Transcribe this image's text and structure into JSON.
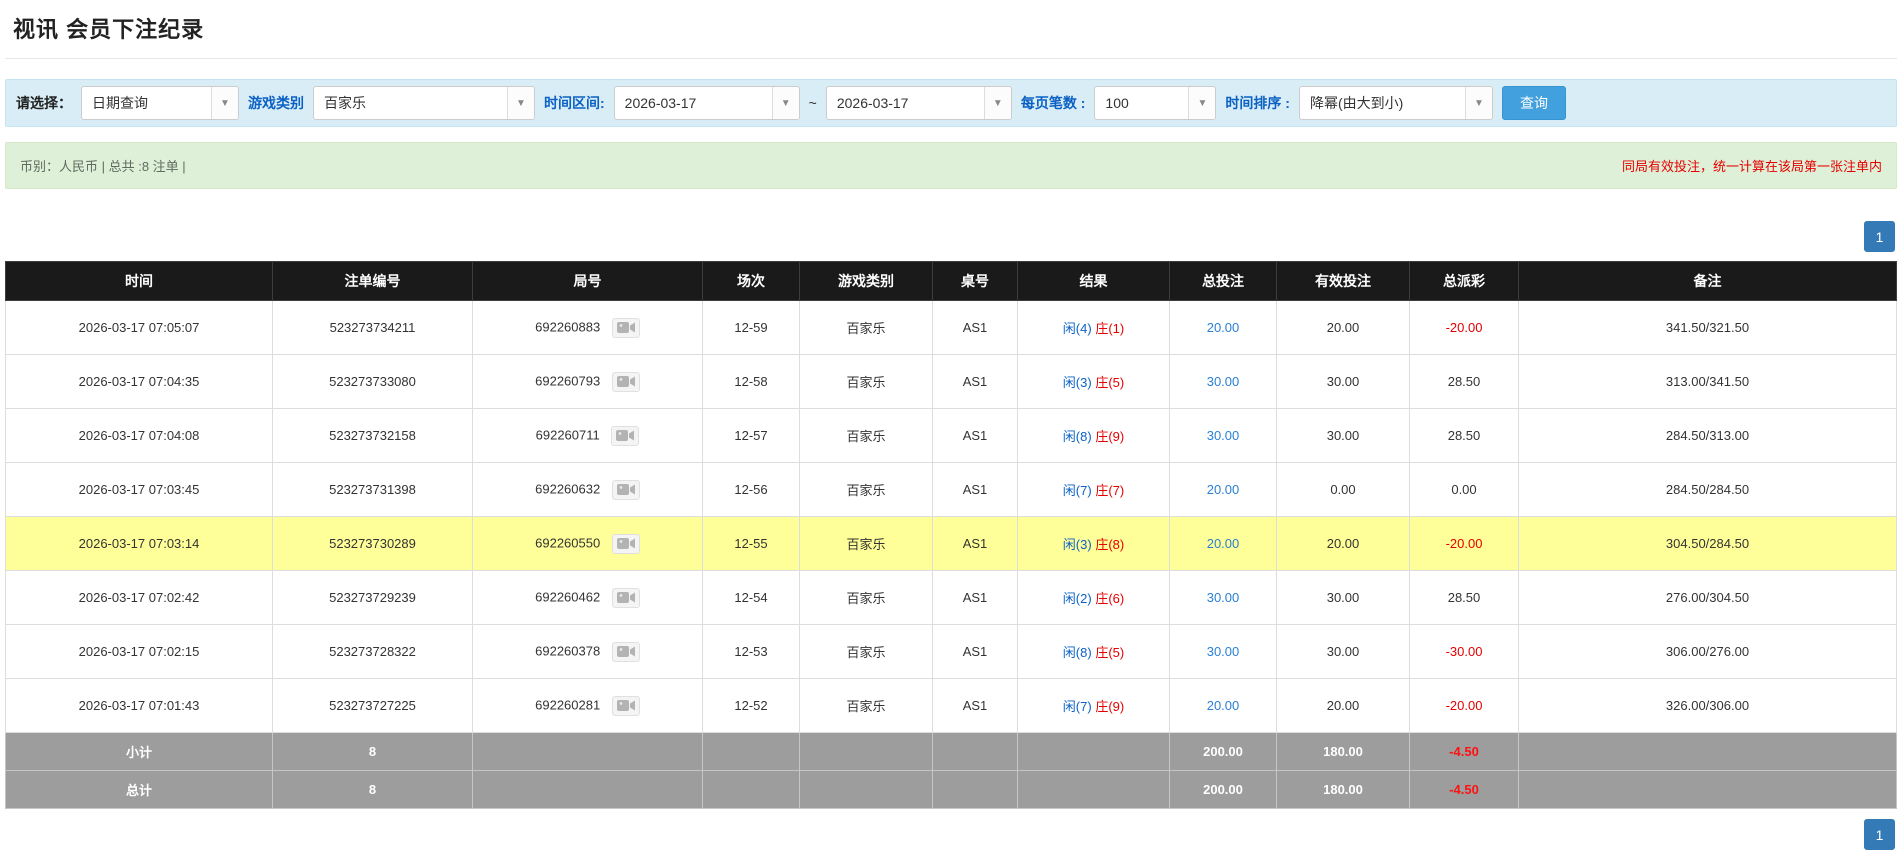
{
  "page": {
    "title": "视讯 会员下注纪录"
  },
  "filters": {
    "select_label": "请选择：",
    "query_type_value": "日期查询",
    "game_category_label": "游戏类别",
    "game_category_value": "百家乐",
    "time_range_label": "时间区间:",
    "date_from_value": "2026-03-17",
    "range_separator": "~",
    "date_to_value": "2026-03-17",
    "page_size_label": "每页笔数 :",
    "page_size_value": "100",
    "sort_label": "时间排序 :",
    "sort_value": "降幂(由大到小)",
    "search_label": "查询"
  },
  "info_bar": {
    "summary": "币别：人民币 | 总共 :8 注单 |",
    "notice": "同局有效投注，统一计算在该局第一张注单内"
  },
  "pagination": {
    "current_page": "1"
  },
  "table": {
    "headers": [
      "时间",
      "注单编号",
      "局号",
      "场次",
      "游戏类别",
      "桌号",
      "结果",
      "总投注",
      "有效投注",
      "总派彩",
      "备注"
    ],
    "rows": [
      {
        "time": "2026-03-17 07:05:07",
        "bet_id": "523273734211",
        "round_id": "692260883",
        "session": "12-59",
        "game": "百家乐",
        "table_no": "AS1",
        "result_player": "闲(4)",
        "result_banker": "庄(1)",
        "total_bet": "20.00",
        "valid_bet": "20.00",
        "payout": "-20.00",
        "remark": "341.50/321.50",
        "highlight": false
      },
      {
        "time": "2026-03-17 07:04:35",
        "bet_id": "523273733080",
        "round_id": "692260793",
        "session": "12-58",
        "game": "百家乐",
        "table_no": "AS1",
        "result_player": "闲(3)",
        "result_banker": "庄(5)",
        "total_bet": "30.00",
        "valid_bet": "30.00",
        "payout": "28.50",
        "remark": "313.00/341.50",
        "highlight": false
      },
      {
        "time": "2026-03-17 07:04:08",
        "bet_id": "523273732158",
        "round_id": "692260711",
        "session": "12-57",
        "game": "百家乐",
        "table_no": "AS1",
        "result_player": "闲(8)",
        "result_banker": "庄(9)",
        "total_bet": "30.00",
        "valid_bet": "30.00",
        "payout": "28.50",
        "remark": "284.50/313.00",
        "highlight": false
      },
      {
        "time": "2026-03-17 07:03:45",
        "bet_id": "523273731398",
        "round_id": "692260632",
        "session": "12-56",
        "game": "百家乐",
        "table_no": "AS1",
        "result_player": "闲(7)",
        "result_banker": "庄(7)",
        "total_bet": "20.00",
        "valid_bet": "0.00",
        "payout": "0.00",
        "remark": "284.50/284.50",
        "highlight": false
      },
      {
        "time": "2026-03-17 07:03:14",
        "bet_id": "523273730289",
        "round_id": "692260550",
        "session": "12-55",
        "game": "百家乐",
        "table_no": "AS1",
        "result_player": "闲(3)",
        "result_banker": "庄(8)",
        "total_bet": "20.00",
        "valid_bet": "20.00",
        "payout": "-20.00",
        "remark": "304.50/284.50",
        "highlight": true
      },
      {
        "time": "2026-03-17 07:02:42",
        "bet_id": "523273729239",
        "round_id": "692260462",
        "session": "12-54",
        "game": "百家乐",
        "table_no": "AS1",
        "result_player": "闲(2)",
        "result_banker": "庄(6)",
        "total_bet": "30.00",
        "valid_bet": "30.00",
        "payout": "28.50",
        "remark": "276.00/304.50",
        "highlight": false
      },
      {
        "time": "2026-03-17 07:02:15",
        "bet_id": "523273728322",
        "round_id": "692260378",
        "session": "12-53",
        "game": "百家乐",
        "table_no": "AS1",
        "result_player": "闲(8)",
        "result_banker": "庄(5)",
        "total_bet": "30.00",
        "valid_bet": "30.00",
        "payout": "-30.00",
        "remark": "306.00/276.00",
        "highlight": false
      },
      {
        "time": "2026-03-17 07:01:43",
        "bet_id": "523273727225",
        "round_id": "692260281",
        "session": "12-52",
        "game": "百家乐",
        "table_no": "AS1",
        "result_player": "闲(7)",
        "result_banker": "庄(9)",
        "total_bet": "20.00",
        "valid_bet": "20.00",
        "payout": "-20.00",
        "remark": "326.00/306.00",
        "highlight": false
      }
    ],
    "subtotal": {
      "label": "小计",
      "count": "8",
      "total_bet": "200.00",
      "valid_bet": "180.00",
      "payout": "-4.50"
    },
    "total": {
      "label": "总计",
      "count": "8",
      "total_bet": "200.00",
      "valid_bet": "180.00",
      "payout": "-4.50"
    }
  },
  "colors": {
    "accent_blue": "#337ab7",
    "filter_bar_bg": "#d9edf7",
    "info_bar_bg": "#dff0d8",
    "header_bg": "#1a1a1a",
    "footer_bg": "#9d9d9d",
    "highlight_yellow": "#ffff99",
    "negative_red": "#e60000",
    "player_blue": "#0b61c4"
  }
}
